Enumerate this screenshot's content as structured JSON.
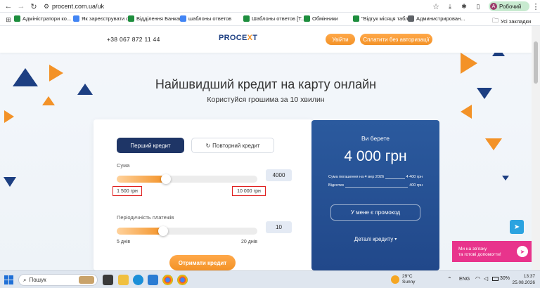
{
  "browser": {
    "url": "procent.com.ua/uk",
    "profile_label": "Робочий",
    "profile_initial": "А"
  },
  "bookmarks": {
    "items": [
      {
        "label": "Адміністратори ко...",
        "color": "#1e8e3e"
      },
      {
        "label": "Як зареєструвати о...",
        "color": "#4285f4"
      },
      {
        "label": "Відділення Банкав...",
        "color": "#1e8e3e"
      },
      {
        "label": "шаблоны ответов",
        "color": "#4285f4"
      },
      {
        "label": "Шаблоны ответов [Т...",
        "color": "#1e8e3e"
      },
      {
        "label": "Обмінники",
        "color": "#1e8e3e"
      },
      {
        "label": "\"Відгук місяця табл...",
        "color": "#1e8e3e"
      },
      {
        "label": "Администрирован...",
        "color": "#5f6368"
      }
    ],
    "all_label": "Усі закладки"
  },
  "site": {
    "phone": "+38 067 872 11 44",
    "logo_a": "PROCE",
    "logo_b": "X",
    "logo_c": "T",
    "login_label": "Увійти",
    "pay_label": "Сплатити без авторизації",
    "hero_title": "Найшвидший кредит на карту онлайн",
    "hero_subtitle": "Користуйся грошима за 10 хвилин"
  },
  "calculator": {
    "tab_first": "Перший кредит",
    "tab_repeat": "Повторний кредит",
    "sum_label": "Сума",
    "sum_value": "4000",
    "sum_fraction": 0.35,
    "sum_min": "1 500 грн",
    "sum_max": "10 000 грн",
    "period_label": "Періодичність платежів",
    "period_value": "10",
    "period_fraction": 0.33,
    "period_min": "5 днів",
    "period_max": "20 днів",
    "submit_label": "Отримати кредит"
  },
  "summary": {
    "title": "Ви берете",
    "amount": "4 000 грн",
    "repay_label": "Сума погашення на 4 вер 2026",
    "repay_value": "4 400 грн",
    "interest_label": "Відсотки",
    "interest_value": "400 грн",
    "promo_label": "У мене є промокод",
    "details_label": "Деталі кредиту"
  },
  "widgets": {
    "help_line1": "Ми на зв'язку",
    "help_line2": "та готові допомогти!"
  },
  "taskbar": {
    "search_placeholder": "Пошук",
    "weather_temp": "29°C",
    "weather_text": "Sunny",
    "lang": "ENG",
    "battery": "30%",
    "time": "13:37",
    "date": "25.08.2026"
  },
  "colors": {
    "accent": "#f39227",
    "navy": "#1d3f82",
    "blue_card": "#2b5a9e"
  }
}
